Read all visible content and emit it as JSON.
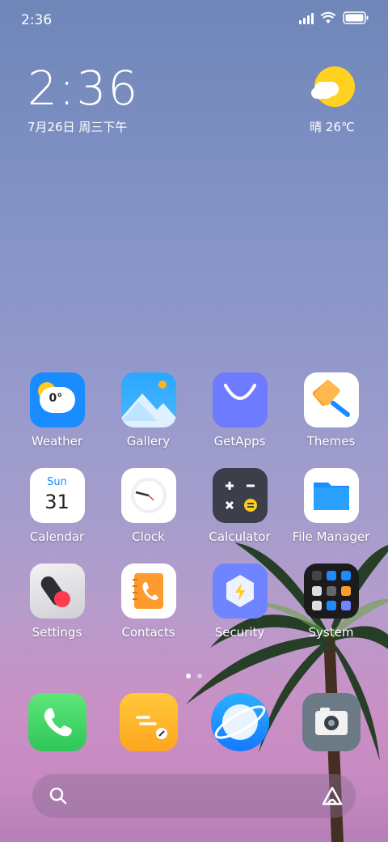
{
  "status_bar": {
    "time": "2:36"
  },
  "clock_widget": {
    "time": "2:36",
    "date": "7月26日 周三下午"
  },
  "weather_widget": {
    "condition_temp": "晴 26℃"
  },
  "apps": [
    {
      "label": "Weather",
      "icon": "weather-icon"
    },
    {
      "label": "Gallery",
      "icon": "gallery-icon"
    },
    {
      "label": "GetApps",
      "icon": "getapps-icon"
    },
    {
      "label": "Themes",
      "icon": "themes-icon"
    },
    {
      "label": "Calendar",
      "icon": "calendar-icon"
    },
    {
      "label": "Clock",
      "icon": "clock-icon"
    },
    {
      "label": "Calculator",
      "icon": "calculator-icon"
    },
    {
      "label": "File Manager",
      "icon": "folder-icon"
    },
    {
      "label": "Settings",
      "icon": "settings-toggle-icon"
    },
    {
      "label": "Contacts",
      "icon": "contacts-icon"
    },
    {
      "label": "Security",
      "icon": "security-shield-icon"
    },
    {
      "label": "System",
      "icon": "system-folder-icon"
    }
  ],
  "weather_icon_text": "0°",
  "calendar_icon": {
    "day": "Sun",
    "date": "31"
  },
  "dock": [
    {
      "icon": "phone-icon"
    },
    {
      "icon": "notes-icon"
    },
    {
      "icon": "browser-icon"
    },
    {
      "icon": "camera-icon"
    }
  ],
  "page_indicator": {
    "pages": 2,
    "active": 1
  },
  "colors": {
    "accent_blue": "#1a8cff",
    "getapps": "#6e7bff",
    "phone_green": "#2fc65a",
    "notes_orange": "#ffa51f"
  }
}
